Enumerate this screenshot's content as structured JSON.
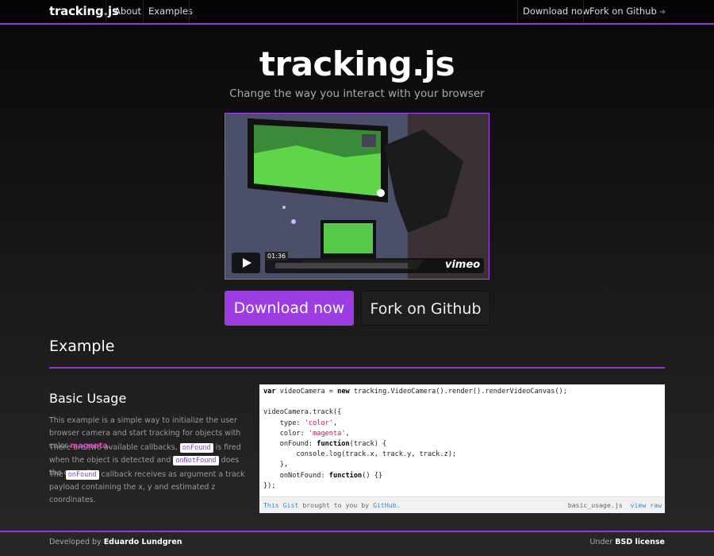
{
  "nav": {
    "brand": "tracking.js",
    "links": [
      "About",
      "Examples"
    ],
    "right_links": [
      "Download now",
      "Fork on Github"
    ]
  },
  "hero": {
    "title": "tracking.js",
    "subtitle": "Change the way you interact with your browser",
    "video": {
      "time": "01:36",
      "brand": "vimeo"
    },
    "buttons": {
      "download": "Download now",
      "fork": "Fork on Github"
    }
  },
  "example": {
    "heading": "Example",
    "subheading": "Basic Usage",
    "p1_a": "This example is a simple way to initialize the user browser camera and start tracking for objects with color ",
    "p1_color": "magenta",
    "p1_b": ".",
    "p2_a": "There are two available callbacks, ",
    "p2_code1": "onFound",
    "p2_b": " is fired when the object is detected and ",
    "p2_code2": "onNotFound",
    "p2_c": " does the opposite.",
    "p3_a": "The ",
    "p3_code": "onFound",
    "p3_b": " callback receives as argument a track payload containing the x, y and estimated z coordinates."
  },
  "gist": {
    "lines": [
      "var videoCamera = new tracking.VideoCamera().render().renderVideoCanvas();",
      "",
      "videoCamera.track({",
      "    type: 'color',",
      "    color: 'magenta',",
      "    onFound: function(track) {",
      "        console.log(track.x, track.y, track.z);",
      "    },",
      "    onNotFound: function() {}",
      "});"
    ],
    "meta_this": "This",
    "meta_gist": "Gist",
    "meta_by": "brought to you by",
    "meta_github": "GitHub",
    "filename": "basic_usage.js",
    "view_raw": "view raw"
  },
  "footer": {
    "developed_by": "Developed by",
    "author": "Eduardo Lundgren",
    "under": "Under",
    "license": "BSD license"
  },
  "colors": {
    "accent": "#8e3bd6",
    "button": "#9b3de0",
    "magenta": "#ff2bd8"
  }
}
